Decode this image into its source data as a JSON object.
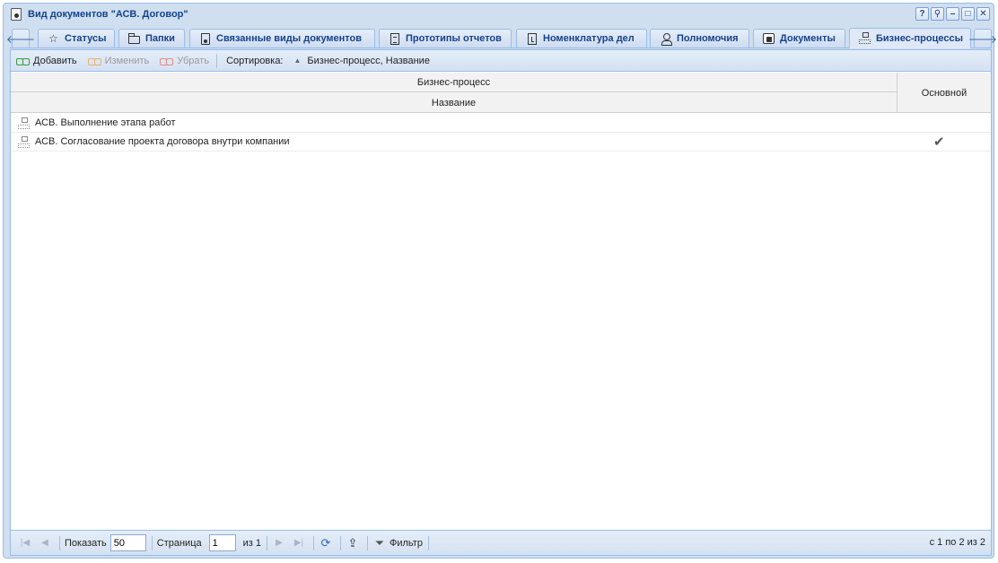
{
  "window": {
    "title": "Вид документов \"АСВ. Договор\"",
    "tools": [
      "?",
      "⚲",
      "–",
      "□",
      "✕"
    ]
  },
  "tabs": [
    {
      "label": "Статусы",
      "icon": "star-icon"
    },
    {
      "label": "Папки",
      "icon": "folder-icon"
    },
    {
      "label": "Связанные виды документов",
      "icon": "doc-settings-icon"
    },
    {
      "label": "Прототипы отчетов",
      "icon": "report-icon"
    },
    {
      "label": "Номенклатура дел",
      "icon": "nomenclature-icon"
    },
    {
      "label": "Полномочия",
      "icon": "person-icon"
    },
    {
      "label": "Документы",
      "icon": "documents-icon"
    },
    {
      "label": "Бизнес-процессы",
      "icon": "process-icon",
      "active": true
    }
  ],
  "toolbar": {
    "add_label": "Добавить",
    "edit_label": "Изменить",
    "remove_label": "Убрать",
    "sort_label": "Сортировка:",
    "sort_value": "Бизнес-процесс, Название"
  },
  "grid": {
    "group_header": "Бизнес-процесс",
    "name_header": "Название",
    "main_header": "Основной",
    "rows": [
      {
        "name": "АСВ. Выполнение этапа работ",
        "main": false
      },
      {
        "name": "АСВ. Согласование проекта договора внутри компании",
        "main": true
      }
    ]
  },
  "pager": {
    "show_label": "Показать",
    "page_size": "50",
    "page_label": "Страница",
    "page": "1",
    "of_label": "из 1",
    "filter_label": "Фильтр",
    "summary": "с 1 по 2 из 2"
  },
  "colors": {
    "accent": "#15428b",
    "panel_border": "#99bbe8",
    "add_green": "#3a9a3a"
  }
}
